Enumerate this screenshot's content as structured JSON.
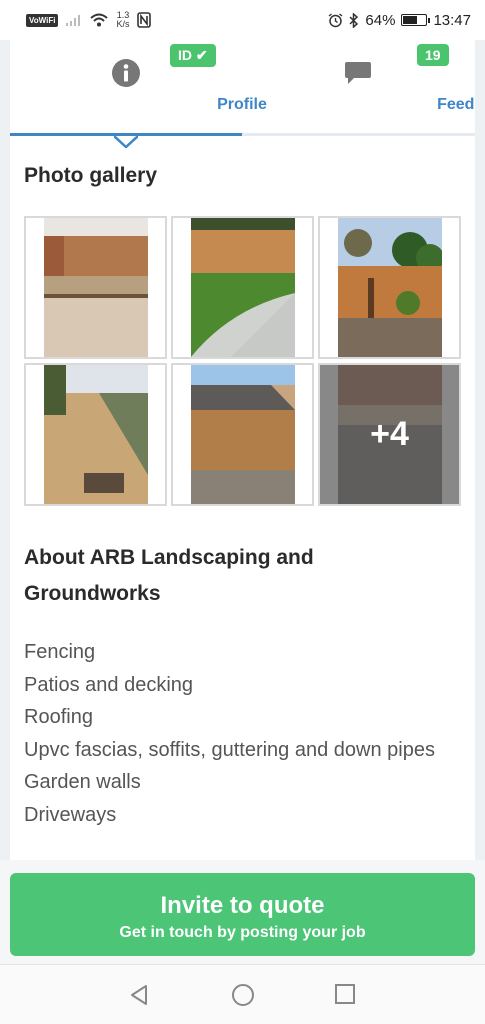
{
  "status_bar": {
    "network_badge": "VoWiFi",
    "net_speed_value": "1.3",
    "net_speed_unit": "K/s",
    "battery": "64%",
    "battery_level": 0.64,
    "time": "13:47",
    "icons": [
      "signal-icon",
      "wifi-icon",
      "nfc-icon",
      "alarm-icon",
      "bluetooth-icon",
      "battery-icon"
    ]
  },
  "tabs": {
    "profile_label": "Profile",
    "feedback_label": "Feedback",
    "id_badge": "ID ✔",
    "feedback_count": "19",
    "active": "Profile"
  },
  "gallery": {
    "title": "Photo gallery",
    "more_count": "+4",
    "photos": [
      "fence-and-gravel-photo",
      "lawn-and-fence-photo",
      "fence-and-planting-photo",
      "gravel-path-photo",
      "roof-and-fence-photo",
      "patio-steps-photo"
    ]
  },
  "about": {
    "title": "About ARB Landscaping and Groundworks",
    "services": [
      "Fencing",
      "Patios and decking",
      "Roofing",
      "Upvc fascias, soffits, guttering and down pipes",
      "Garden walls",
      "Driveways"
    ]
  },
  "cta": {
    "title": "Invite to quote",
    "subtitle": "Get in touch by posting your job"
  },
  "colors": {
    "accent_blue": "#3f86c8",
    "badge_green": "#4cc46e",
    "cta_green": "#4cc577"
  },
  "nav": {
    "icons": [
      "back-icon",
      "home-icon",
      "recents-icon"
    ]
  }
}
